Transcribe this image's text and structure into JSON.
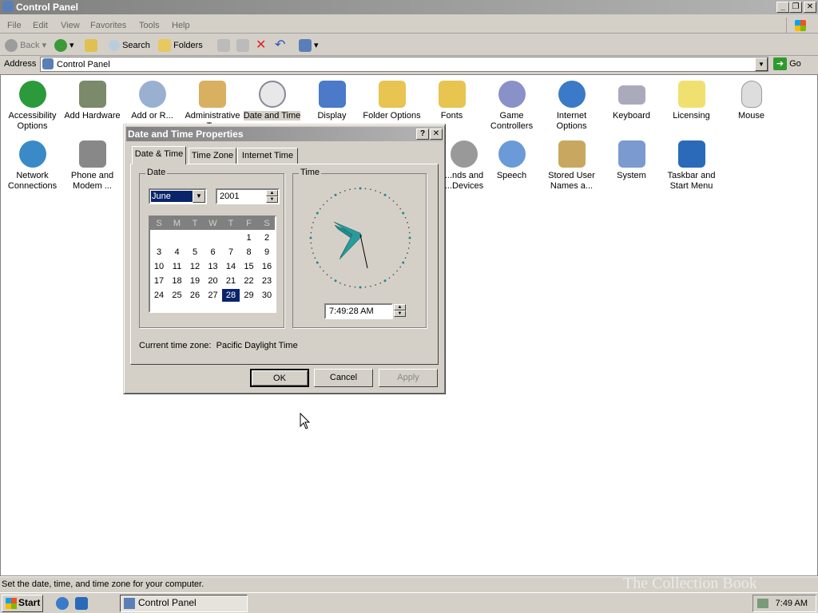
{
  "window": {
    "title": "Control Panel"
  },
  "menu": [
    "File",
    "Edit",
    "View",
    "Favorites",
    "Tools",
    "Help"
  ],
  "toolbar": {
    "back": "Back",
    "search": "Search",
    "folders": "Folders"
  },
  "address": {
    "label": "Address",
    "value": "Control Panel",
    "go": "Go"
  },
  "items": [
    "Accessibility Options",
    "Add Hardware",
    "Add or R...",
    "Administrative T...",
    "Date and Time",
    "Display",
    "Folder Options",
    "Fonts",
    "Game Controllers",
    "Internet Options",
    "Keyboard",
    "Licensing",
    "Mouse",
    "Network Connections",
    "Phone and Modem ...",
    "...nds and ...Devices",
    "Speech",
    "Stored User Names a...",
    "System",
    "Taskbar and Start Menu"
  ],
  "dialog": {
    "title": "Date and Time Properties",
    "tabs": [
      "Date & Time",
      "Time Zone",
      "Internet Time"
    ],
    "date_group": "Date",
    "time_group": "Time",
    "month": "June",
    "year": "2001",
    "weekdays": [
      "S",
      "M",
      "T",
      "W",
      "T",
      "F",
      "S"
    ],
    "selected_day": 28,
    "time_value": "7:49:28 AM",
    "timezone_label": "Current time zone:",
    "timezone_value": "Pacific Daylight Time",
    "ok": "OK",
    "cancel": "Cancel",
    "apply": "Apply"
  },
  "status": "Set the date, time, and time zone for your computer.",
  "taskbar": {
    "start": "Start",
    "task": "Control Panel",
    "time": "7:49 AM"
  },
  "watermark": "The Collection Book",
  "colors": {
    "accent": "#0a246a",
    "clock_hand": "#1f8a8a",
    "clock_dot": "#1f8a8a"
  }
}
